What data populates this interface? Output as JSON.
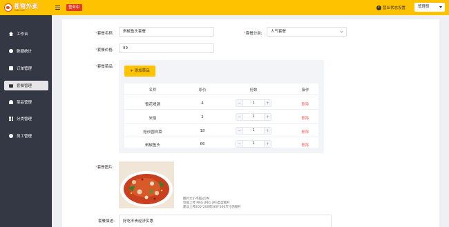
{
  "header": {
    "logo_text": "苍穹外卖",
    "logo_sub": "TAKE OUT",
    "status_tag": "营业中",
    "shop_status_label": "营业状态设置",
    "user_label": "管理员"
  },
  "sidebar": {
    "items": [
      {
        "label": "工作台",
        "icon": "home-icon"
      },
      {
        "label": "数据统计",
        "icon": "stats-icon"
      },
      {
        "label": "订单管理",
        "icon": "order-icon"
      },
      {
        "label": "套餐管理",
        "icon": "combo-icon",
        "active": true
      },
      {
        "label": "菜品管理",
        "icon": "dish-icon"
      },
      {
        "label": "分类管理",
        "icon": "category-icon"
      },
      {
        "label": "员工管理",
        "icon": "employee-icon"
      }
    ]
  },
  "form": {
    "name_label": "套餐名称:",
    "name_value": "剁椒鱼头套餐",
    "category_label": "套餐分类:",
    "category_value": "人气套餐",
    "price_label": "套餐价格:",
    "price_value": "99",
    "dishes_label": "套餐菜品:",
    "add_dish_button": "+ 添加菜品",
    "table_headers": [
      "名称",
      "原价",
      "份数",
      "操作"
    ],
    "dishes": [
      {
        "name": "雪花啤酒",
        "price": "4",
        "qty": "1",
        "action": "删除"
      },
      {
        "name": "米饭",
        "price": "2",
        "qty": "1",
        "action": "删除"
      },
      {
        "name": "炝炒圆白菜",
        "price": "18",
        "qty": "1",
        "action": "删除"
      },
      {
        "name": "剁椒鱼头",
        "price": "66",
        "qty": "1",
        "action": "删除"
      }
    ],
    "stepper_minus": "−",
    "stepper_plus": "+",
    "image_label": "套餐图片:",
    "image_hint_1": "图片大小不超过2M",
    "image_hint_2": "仅能上传 PNG JPEG JPG类型图片",
    "image_hint_3": "建议上传200*200或300*300尺寸的图片",
    "desc_label": "套餐描述:",
    "desc_value": "好吃不贵经济实惠",
    "required_mark": "*"
  },
  "colors": {
    "brand": "#ffc200",
    "sidebar": "#343744",
    "status_tag": "#e13b24",
    "delete": "#f56c6c"
  }
}
